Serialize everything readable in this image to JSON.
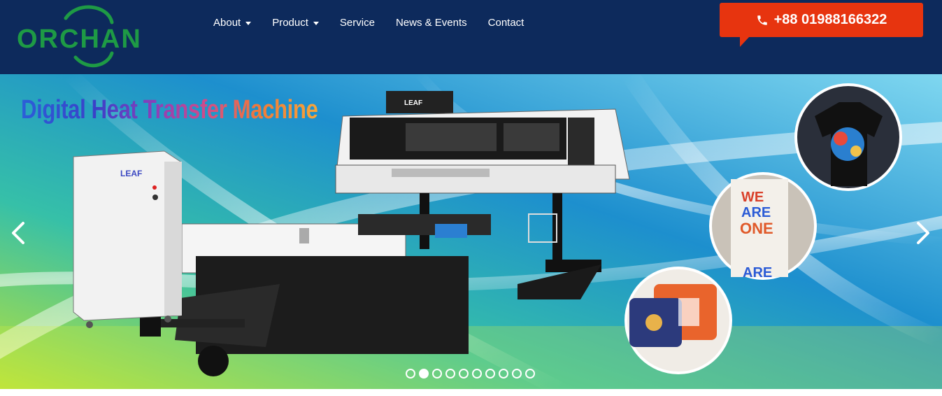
{
  "brand": {
    "logo_text": "ORCHAN",
    "logo_color": "#1e9a45"
  },
  "nav": {
    "items": [
      {
        "label": "About",
        "dropdown": true
      },
      {
        "label": "Product",
        "dropdown": true
      },
      {
        "label": "Service",
        "dropdown": false
      },
      {
        "label": "News & Events",
        "dropdown": false
      },
      {
        "label": "Contact",
        "dropdown": false
      }
    ]
  },
  "contact": {
    "phone": "+88 01988166322",
    "icon": "phone-icon",
    "accent": "#e7340f"
  },
  "slider": {
    "title": "Digital Heat Transfer Machine",
    "machine_brand_1": "LEAF",
    "machine_brand_2": "LEAF",
    "tote_text_1": "WE",
    "tote_text_2": "ARE",
    "tote_text_3": "ONE",
    "tote_text_4": "ARE",
    "slide_count": 10,
    "active_slide": 2,
    "prev_icon": "chevron-left-icon",
    "next_icon": "chevron-right-icon"
  },
  "colors": {
    "navbar": "#0d2a5c",
    "accent": "#e7340f"
  }
}
